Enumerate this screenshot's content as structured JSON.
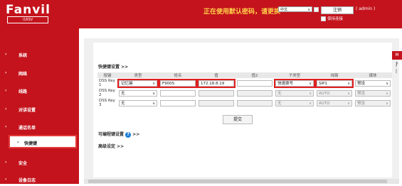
{
  "header": {
    "logo": "Fanvil",
    "model": "i16SV",
    "warning": "正在使用默认密码，请更换",
    "language": "中文",
    "logout_label": "注销",
    "user": "( admin )",
    "remember_label": "保持连接"
  },
  "sidebar": {
    "items": [
      {
        "label": "系统",
        "arrow": "›"
      },
      {
        "label": "网络",
        "arrow": "›"
      },
      {
        "label": "线路",
        "arrow": "›"
      },
      {
        "label": "对讲设置",
        "arrow": "›"
      },
      {
        "label": "通话名单",
        "arrow": "›"
      },
      {
        "label": "快捷键",
        "arrow": "›"
      },
      {
        "label": "安全",
        "arrow": "›"
      },
      {
        "label": "设备日志",
        "arrow": "›"
      }
    ]
  },
  "main": {
    "section_title": "快捷键设置 >>",
    "columns": [
      "按键",
      "类型",
      "姓名",
      "值",
      "值2",
      "子类型",
      "线路",
      "媒体"
    ],
    "rows": [
      {
        "key": "DSS Key 1",
        "type": "记忆键",
        "name": "F900S",
        "value": "172.18.8.19",
        "value2": "",
        "subtype": "快速拨号",
        "line": "SIP1",
        "media": "预设"
      },
      {
        "key": "DSS Key 2",
        "type": "无",
        "name": "",
        "value": "",
        "value2": "",
        "subtype": "无",
        "line": "AUTO",
        "media": "预设"
      },
      {
        "key": "DSS Key 3",
        "type": "无",
        "name": "",
        "value": "",
        "value2": "",
        "subtype": "无",
        "line": "AUTO",
        "media": "预设"
      }
    ],
    "submit_label": "提交",
    "programmable_title": "可编程键设置",
    "programmable_suffix": ">>",
    "advanced_title": "高级设定 >>"
  },
  "right_panel": {
    "tab": "M",
    "ticks": "扌\n'\n|"
  },
  "colors": {
    "brand": "#c4131c",
    "warning": "#ffd24a",
    "highlight": "#e02020",
    "help": "#1e7fd6"
  }
}
